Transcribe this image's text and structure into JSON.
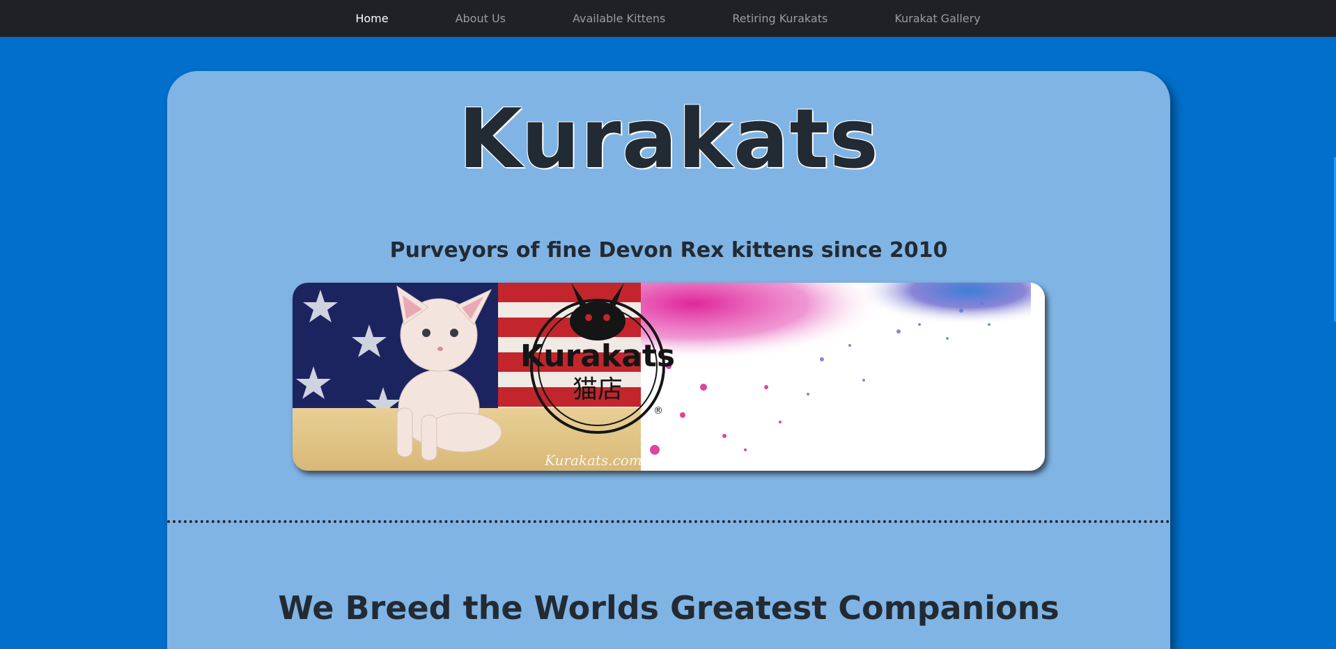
{
  "nav": {
    "items": [
      {
        "label": "Home",
        "active": true
      },
      {
        "label": "About Us",
        "active": false
      },
      {
        "label": "Available Kittens",
        "active": false
      },
      {
        "label": "Retiring Kurakats",
        "active": false
      },
      {
        "label": "Kurakat Gallery",
        "active": false
      }
    ]
  },
  "hero": {
    "title": "Kurakats",
    "tagline": "Purveyors of fine Devon Rex kittens since 2010"
  },
  "banner": {
    "logo_text": "Kurakats",
    "logo_subtext": "猫店",
    "registered_mark": "®",
    "watermark": "Kurakats.com"
  },
  "section": {
    "heading": "We Breed the Worlds Greatest Companions"
  },
  "colors": {
    "page_bg": "#0070cc",
    "navbar_bg": "#1f2124",
    "card_bg": "#80b4e4",
    "text_dark": "#222a33"
  }
}
